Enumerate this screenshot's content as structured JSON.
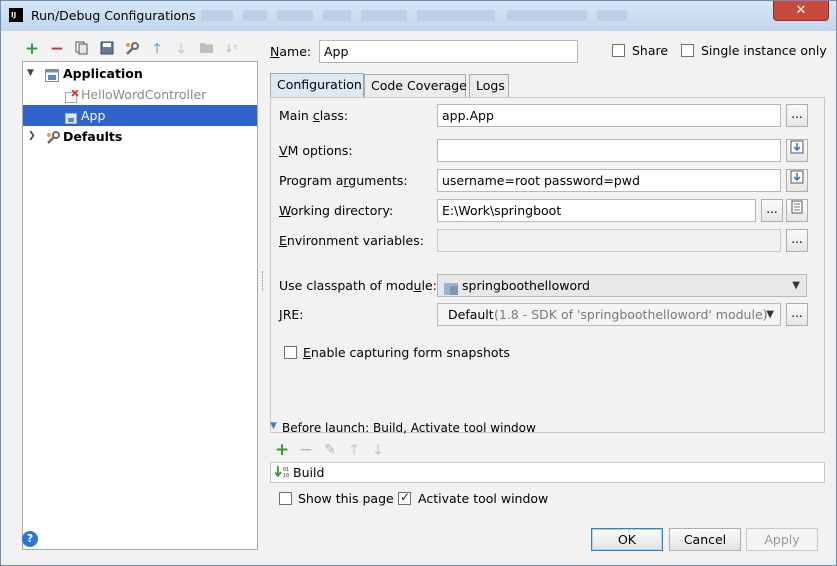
{
  "window": {
    "title": "Run/Debug Configurations",
    "app_icon_text": "IJ",
    "close_glyph": "✕"
  },
  "toolbar": {
    "icons": [
      "add-icon",
      "remove-icon",
      "copy-icon",
      "save-icon",
      "wrench-icon",
      "move-up-icon",
      "move-down-icon",
      "folder-icon",
      "sort-icon"
    ]
  },
  "tree": {
    "items": [
      {
        "label": "Application",
        "bold": true,
        "level": 0,
        "expanded": true
      },
      {
        "label": "HelloWordController",
        "bold": false,
        "level": 1,
        "disabled": true
      },
      {
        "label": "App",
        "bold": false,
        "level": 1,
        "selected": true
      },
      {
        "label": "Defaults",
        "bold": true,
        "level": 0,
        "expanded": false
      }
    ]
  },
  "name": {
    "label": "Name:",
    "value": "App"
  },
  "share": {
    "label": "Share",
    "checked": false
  },
  "single_instance": {
    "label": "Single instance only",
    "checked": false
  },
  "tabs": [
    {
      "label": "Configuration",
      "active": true
    },
    {
      "label": "Code Coverage",
      "active": false
    },
    {
      "label": "Logs",
      "active": false
    }
  ],
  "config": {
    "main_class": {
      "label": "Main class:",
      "value": "app.App"
    },
    "vm_options": {
      "label": "VM options:",
      "value": ""
    },
    "program_arguments": {
      "label": "Program arguments:",
      "value": "username=root password=pwd"
    },
    "working_directory": {
      "label": "Working directory:",
      "value": "E:\\Work\\springboot"
    },
    "environment_variables": {
      "label": "Environment variables:",
      "value": ""
    },
    "classpath_module": {
      "label": "Use classpath of module:",
      "value": "springboothelloword"
    },
    "jre": {
      "label": "JRE:",
      "value": "Default",
      "hint": "(1.8 - SDK of 'springboothelloword' module)"
    },
    "capture_snapshots": {
      "label": "Enable capturing form snapshots",
      "checked": false
    },
    "ellipsis": "..."
  },
  "before_launch": {
    "header": "Before launch: Build, Activate tool window",
    "items": [
      "Build"
    ],
    "show_this_page": {
      "label": "Show this page",
      "checked": false
    },
    "activate_tool_window": {
      "label": "Activate tool window",
      "checked": true
    }
  },
  "buttons": {
    "ok": "OK",
    "cancel": "Cancel",
    "apply": "Apply",
    "help": "?"
  }
}
